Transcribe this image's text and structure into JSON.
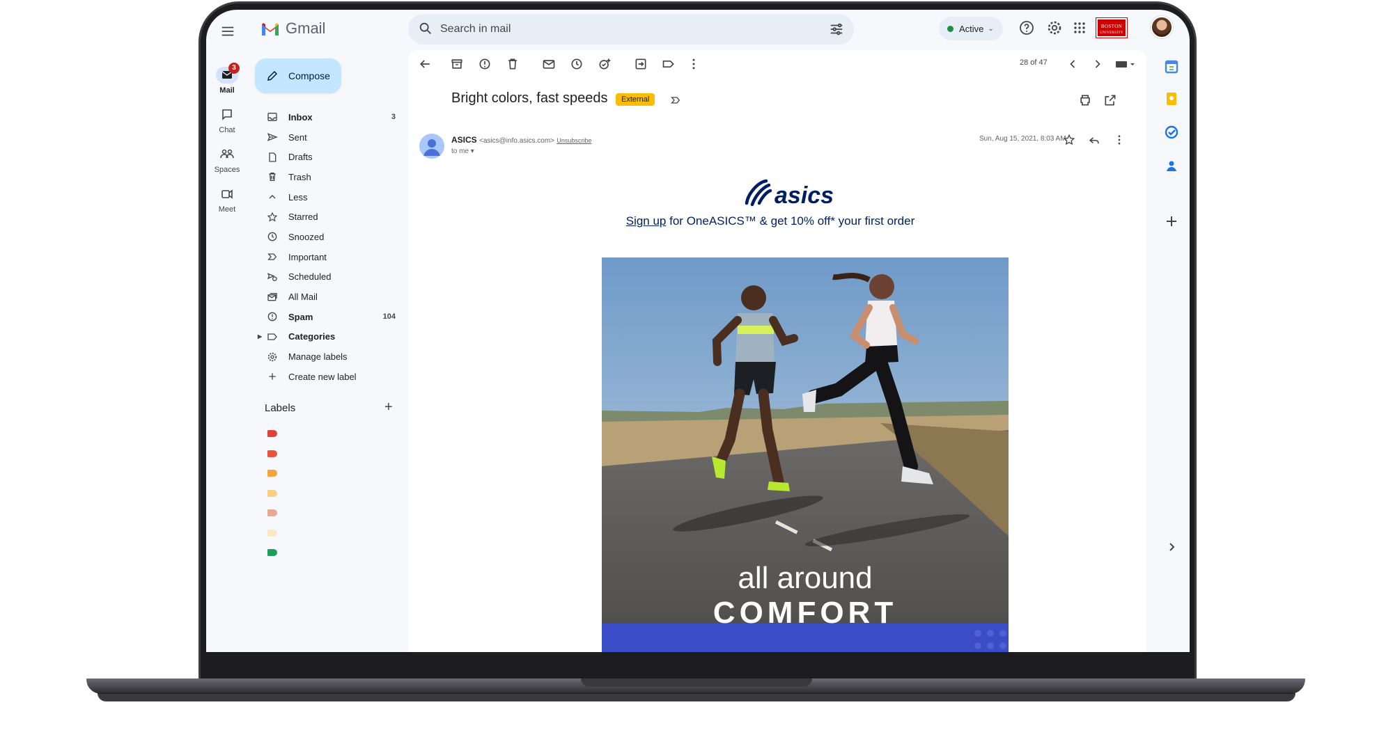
{
  "app": {
    "name": "Gmail",
    "search_placeholder": "Search in mail"
  },
  "status": {
    "label": "Active",
    "color": "#1e8e3e"
  },
  "org_badge": {
    "line1": "BOSTON",
    "line2": "UNIVERSITY"
  },
  "rail": [
    {
      "label": "Mail",
      "icon": "mail-icon",
      "badge": "3",
      "active": true
    },
    {
      "label": "Chat",
      "icon": "chat-icon"
    },
    {
      "label": "Spaces",
      "icon": "spaces-icon"
    },
    {
      "label": "Meet",
      "icon": "meet-icon"
    }
  ],
  "compose_label": "Compose",
  "nav": [
    {
      "label": "Inbox",
      "count": "3",
      "bold": true,
      "icon": "inbox-icon"
    },
    {
      "label": "Sent",
      "icon": "sent-icon"
    },
    {
      "label": "Drafts",
      "icon": "drafts-icon"
    },
    {
      "label": "Trash",
      "icon": "trash-icon"
    },
    {
      "label": "Less",
      "icon": "chevron-up-icon"
    },
    {
      "label": "Starred",
      "icon": "star-icon"
    },
    {
      "label": "Snoozed",
      "icon": "clock-icon"
    },
    {
      "label": "Important",
      "icon": "important-icon"
    },
    {
      "label": "Scheduled",
      "icon": "scheduled-icon"
    },
    {
      "label": "All Mail",
      "icon": "all-mail-icon"
    },
    {
      "label": "Spam",
      "count": "104",
      "bold": true,
      "icon": "spam-icon"
    },
    {
      "label": "Categories",
      "bold": true,
      "icon": "label-icon"
    },
    {
      "label": "Manage labels",
      "icon": "gear-icon"
    },
    {
      "label": "Create new label",
      "icon": "plus-icon"
    }
  ],
  "labels_heading": "Labels",
  "label_colors": [
    "#db4437",
    "#e8533f",
    "#f4a43a",
    "#f9cf86",
    "#e8a88f",
    "#fbe7c4",
    "#1e9e5a"
  ],
  "toolbar": {
    "pager": "28 of 47"
  },
  "email": {
    "subject": "Bright colors, fast speeds",
    "badge": "External",
    "sender_name": "ASICS",
    "sender_email": "<asics@info.asics.com>",
    "unsubscribe": "Unsubscribe",
    "to": "to me",
    "date": "Sun, Aug 15, 2021, 8:03 AM",
    "brand": "asics",
    "promo_link": "Sign up",
    "promo_text": " for OneASICS™ & get 10% off* your first order",
    "hero_line1": "all around",
    "hero_line2": "COMFORT"
  },
  "colors": {
    "brand_navy": "#001e62",
    "compose_bg": "#c2e7ff",
    "hero_band": "#3a4cc6"
  }
}
